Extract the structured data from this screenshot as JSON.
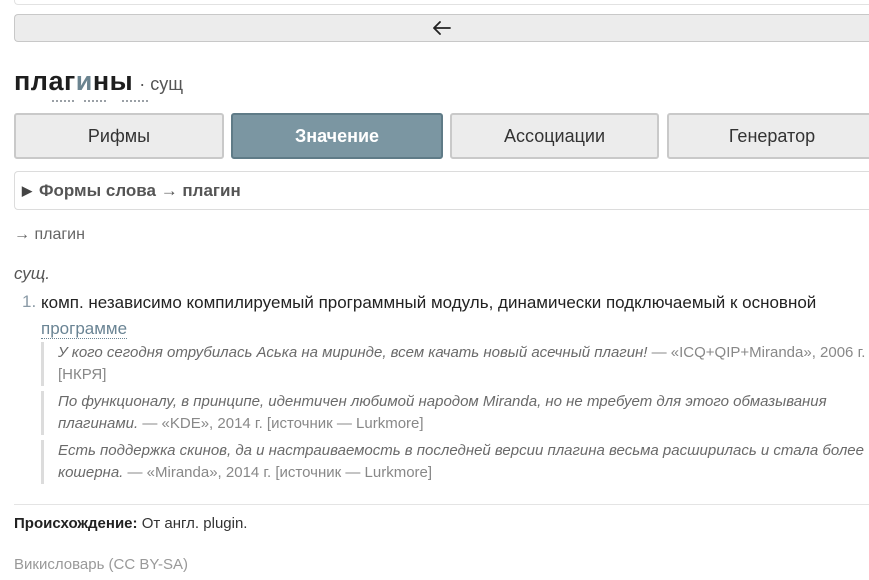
{
  "header": {
    "back_icon": "arrow-left-icon"
  },
  "title": {
    "word_pre": "плаг",
    "word_stress": "и",
    "word_post": "ны",
    "pos_label": "· сущ"
  },
  "tabs": [
    {
      "label": "Рифмы",
      "active": false
    },
    {
      "label": "Значение",
      "active": true
    },
    {
      "label": "Ассоциации",
      "active": false
    },
    {
      "label": "Генератор",
      "active": false
    }
  ],
  "forms": {
    "label": "Формы слова → плагин"
  },
  "lemma": {
    "text": "→ плагин"
  },
  "pos": {
    "text": "сущ."
  },
  "definitions": [
    {
      "number": "1.",
      "text": "комп. независимо компилируемый программный модуль, динамически подключаемый к основной",
      "link": "программе"
    }
  ],
  "examples": [
    {
      "quote": "У кого сегодня отрубилась Аська на миринде, всем качать новый асечный плагин!",
      "source": "— «ICQ+QIP+Miranda», 2006 г. [НКРЯ]"
    },
    {
      "quote": "По функционалу, в принципе, идентичен любимой народом Miranda, но не требует для этого обмазывания плагинами.",
      "source": "— «KDE», 2014 г. [источник — Lurkmore]"
    },
    {
      "quote": "Есть поддержка скинов, да и настраиваемость в последней версии плагина весьма расширилась и стала более кошерна.",
      "source": "— «Miranda», 2014 г. [источник — Lurkmore]"
    }
  ],
  "origin": {
    "label": "Происхождение:",
    "text": "От англ. plugin."
  },
  "license": {
    "text": "Викисловарь (CC BY-SA)"
  },
  "colors": {
    "accent": "#7b96a2",
    "tab_bg": "#ececec",
    "link": "#6a8494"
  }
}
